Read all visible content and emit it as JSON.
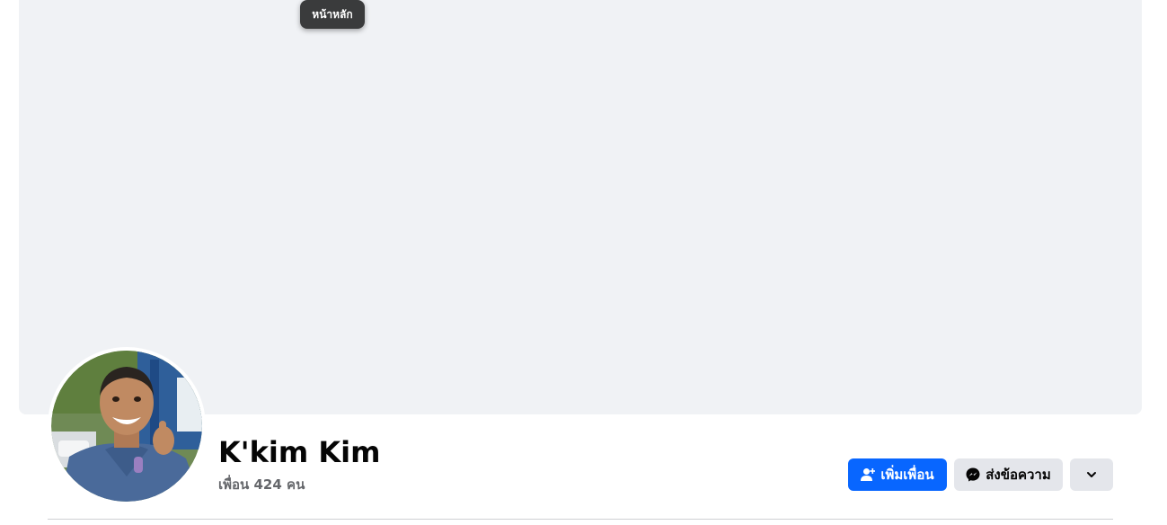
{
  "tooltip": {
    "text": "หน้าหลัก"
  },
  "profile": {
    "name": "K'kim Kim",
    "friends_count": "เพื่อน 424 คน"
  },
  "actions": {
    "add_friend_label": "เพิ่มเพื่อน",
    "message_label": "ส่งข้อความ",
    "add_friend_icon": "person-add-icon",
    "message_icon": "messenger-icon",
    "more_icon": "chevron-down-icon"
  },
  "colors": {
    "primary_button": "#0866ff",
    "secondary_button": "#e4e6eb",
    "cover_background": "#f0f2f5",
    "tooltip_background": "#3a3b3c"
  }
}
